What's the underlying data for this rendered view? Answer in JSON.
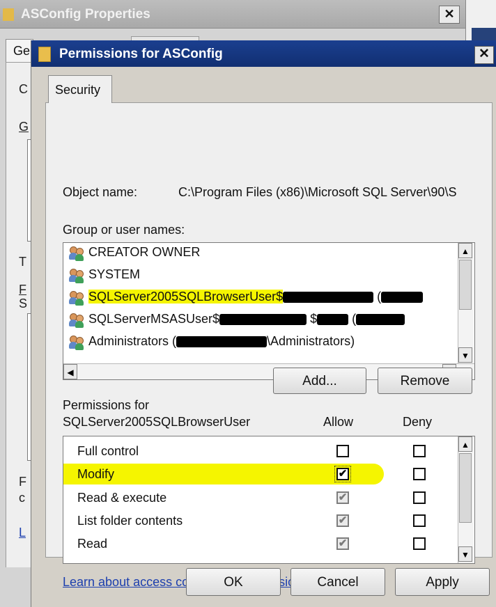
{
  "background_window": {
    "title": "ASConfig Properties",
    "close_glyph": "✕",
    "tab_label": "Ge",
    "letters": [
      "C",
      "G",
      "T",
      "F",
      "S",
      "F",
      "c",
      "L"
    ]
  },
  "dialog": {
    "title": "Permissions for ASConfig",
    "close_glyph": "✕",
    "tab_label": "Security",
    "object_name_label": "Object name:",
    "object_name_value": "C:\\Program Files (x86)\\Microsoft SQL Server\\90\\S",
    "group_label": "Group or user names:",
    "users": [
      {
        "prefix": "CREATOR OWNER",
        "suffix": ""
      },
      {
        "prefix": "SYSTEM",
        "suffix": ""
      },
      {
        "prefix": "SQLServer2005SQLBrowserUser$",
        "suffix": " (",
        "selected": true
      },
      {
        "prefix": "SQLServerMSASUser$",
        "suffix": " $",
        "suffix2": " ("
      },
      {
        "prefix": "Administrators (",
        "suffix": "\\Administrators)"
      }
    ],
    "add_button": "Add...",
    "remove_button": "Remove",
    "permissions_for_line1": "Permissions for",
    "permissions_for_line2": "SQLServer2005SQLBrowserUser",
    "allow_header": "Allow",
    "deny_header": "Deny",
    "permissions": [
      {
        "name": "Full control",
        "allow": "",
        "deny": ""
      },
      {
        "name": "Modify",
        "allow": "✔",
        "deny": ""
      },
      {
        "name": "Read & execute",
        "allow": "✔",
        "deny": ""
      },
      {
        "name": "List folder contents",
        "allow": "✔",
        "deny": ""
      },
      {
        "name": "Read",
        "allow": "✔",
        "deny": ""
      }
    ],
    "learn_link": "Learn about access control and permissions",
    "ok_button": "OK",
    "cancel_button": "Cancel",
    "apply_button": "Apply",
    "scroll_up": "▲",
    "scroll_down": "▼",
    "scroll_left": "◀",
    "scroll_right": "▶"
  },
  "colors": {
    "title_bar": "#1b3f8f",
    "highlight": "#f5f500",
    "link": "#1c3fae"
  }
}
